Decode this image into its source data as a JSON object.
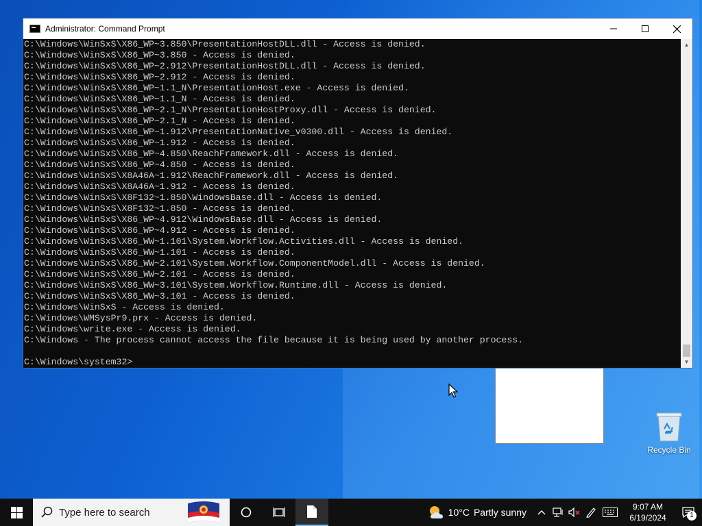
{
  "window": {
    "title": "Administrator: Command Prompt",
    "minimize_glyph": "—",
    "maximize_glyph": "☐",
    "close_glyph": "✕"
  },
  "console": {
    "lines": [
      "C:\\Windows\\WinSxS\\X86_WP~3.850\\PresentationHostDLL.dll - Access is denied.",
      "C:\\Windows\\WinSxS\\X86_WP~3.850 - Access is denied.",
      "C:\\Windows\\WinSxS\\X86_WP~2.912\\PresentationHostDLL.dll - Access is denied.",
      "C:\\Windows\\WinSxS\\X86_WP~2.912 - Access is denied.",
      "C:\\Windows\\WinSxS\\X86_WP~1.1_N\\PresentationHost.exe - Access is denied.",
      "C:\\Windows\\WinSxS\\X86_WP~1.1_N - Access is denied.",
      "C:\\Windows\\WinSxS\\X86_WP~2.1_N\\PresentationHostProxy.dll - Access is denied.",
      "C:\\Windows\\WinSxS\\X86_WP~2.1_N - Access is denied.",
      "C:\\Windows\\WinSxS\\X86_WP~1.912\\PresentationNative_v0300.dll - Access is denied.",
      "C:\\Windows\\WinSxS\\X86_WP~1.912 - Access is denied.",
      "C:\\Windows\\WinSxS\\X86_WP~4.850\\ReachFramework.dll - Access is denied.",
      "C:\\Windows\\WinSxS\\X86_WP~4.850 - Access is denied.",
      "C:\\Windows\\WinSxS\\X8A46A~1.912\\ReachFramework.dll - Access is denied.",
      "C:\\Windows\\WinSxS\\X8A46A~1.912 - Access is denied.",
      "C:\\Windows\\WinSxS\\X8F132~1.850\\WindowsBase.dll - Access is denied.",
      "C:\\Windows\\WinSxS\\X8F132~1.850 - Access is denied.",
      "C:\\Windows\\WinSxS\\X86_WP~4.912\\WindowsBase.dll - Access is denied.",
      "C:\\Windows\\WinSxS\\X86_WP~4.912 - Access is denied.",
      "C:\\Windows\\WinSxS\\X86_WW~1.101\\System.Workflow.Activities.dll - Access is denied.",
      "C:\\Windows\\WinSxS\\X86_WW~1.101 - Access is denied.",
      "C:\\Windows\\WinSxS\\X86_WW~2.101\\System.Workflow.ComponentModel.dll - Access is denied.",
      "C:\\Windows\\WinSxS\\X86_WW~2.101 - Access is denied.",
      "C:\\Windows\\WinSxS\\X86_WW~3.101\\System.Workflow.Runtime.dll - Access is denied.",
      "C:\\Windows\\WinSxS\\X86_WW~3.101 - Access is denied.",
      "C:\\Windows\\WinSxS - Access is denied.",
      "C:\\Windows\\WMSysPr9.prx - Access is denied.",
      "C:\\Windows\\write.exe - Access is denied.",
      "C:\\Windows - The process cannot access the file because it is being used by another process.",
      "",
      "C:\\Windows\\system32>"
    ]
  },
  "desktop": {
    "recycle_bin_label": "Recycle Bin"
  },
  "taskbar": {
    "search_placeholder": "Type here to search",
    "weather_temp": "10°C",
    "weather_text": "Partly sunny",
    "time": "9:07 AM",
    "date": "6/19/2024",
    "notification_count": "1"
  }
}
